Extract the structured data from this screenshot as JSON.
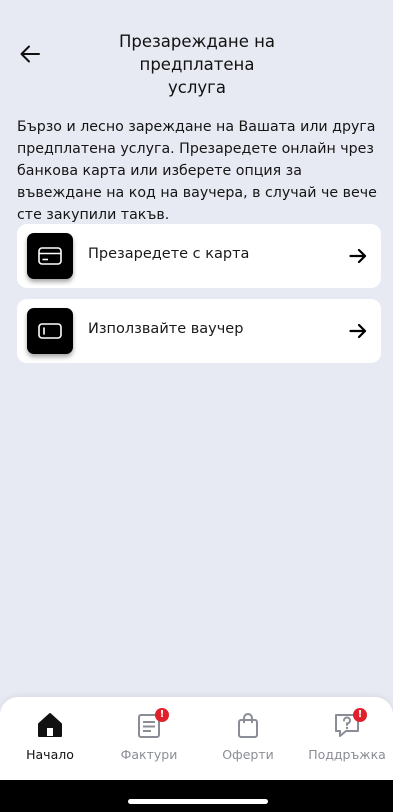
{
  "header": {
    "title_line1": "Презареждане на предплатена",
    "title_line2": "услуга"
  },
  "intro": "Бързо и лесно зареждане на Вашата или друга предплатена услуга. Презаредете онлайн чрез банкова карта или изберете опция за въвеждане на код на ваучера, в случай че вече сте закупили такъв.",
  "options": [
    {
      "label": "Презаредете с карта",
      "icon": "credit-card-icon"
    },
    {
      "label": "Използвайте ваучер",
      "icon": "voucher-icon"
    }
  ],
  "tabs": [
    {
      "label": "Начало",
      "icon": "home-icon",
      "active": true
    },
    {
      "label": "Фактури",
      "icon": "invoice-icon",
      "badge": "!"
    },
    {
      "label": "Оферти",
      "icon": "shopping-bag-icon"
    },
    {
      "label": "Поддръжка",
      "icon": "support-chat-icon",
      "badge": "!"
    }
  ],
  "colors": {
    "background": "#e8eaf3",
    "card": "#ffffff",
    "icon_tile": "#000000",
    "badge": "#e0202a",
    "tab_inactive": "#8b8d96"
  }
}
